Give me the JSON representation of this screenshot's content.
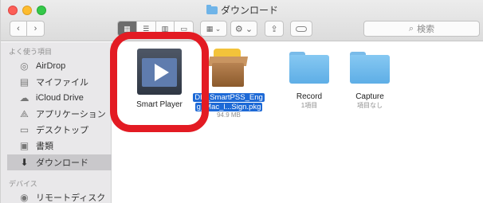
{
  "window": {
    "title": "ダウンロード"
  },
  "toolbar": {
    "back_icon": "‹",
    "forward_icon": "›",
    "views": [
      "▦",
      "☰",
      "▥",
      "▭"
    ],
    "arrange_icon": "▦ ⌄",
    "action_icon": "⚙ ⌄",
    "share_icon": "⇪",
    "search_placeholder": "検索"
  },
  "sidebar": {
    "favorites_header": "よく使う項目",
    "items": [
      {
        "label": "AirDrop",
        "icon": "airdrop-icon"
      },
      {
        "label": "マイファイル",
        "icon": "all-files-icon"
      },
      {
        "label": "iCloud Drive",
        "icon": "cloud-icon"
      },
      {
        "label": "アプリケーション",
        "icon": "applications-icon"
      },
      {
        "label": "デスクトップ",
        "icon": "desktop-icon"
      },
      {
        "label": "書類",
        "icon": "documents-icon"
      },
      {
        "label": "ダウンロード",
        "icon": "downloads-icon",
        "selected": true
      }
    ],
    "devices_header": "デバイス",
    "devices": [
      {
        "label": "リモートディスク",
        "icon": "disc-icon"
      }
    ]
  },
  "files": [
    {
      "name": "Smart Player",
      "kind": "app"
    },
    {
      "name_line1": "DH_SmartPSS_Eng",
      "name_line2": "g_Mac_l...Sign.pkg",
      "size": "94.9 MB",
      "kind": "package",
      "selected": true
    },
    {
      "name": "Record",
      "sub": "1項目",
      "kind": "folder"
    },
    {
      "name": "Capture",
      "sub": "項目なし",
      "kind": "folder"
    }
  ],
  "colors": {
    "highlight": "#e31b23",
    "selection": "#1d69d6",
    "folder": "#6fb4e8"
  }
}
